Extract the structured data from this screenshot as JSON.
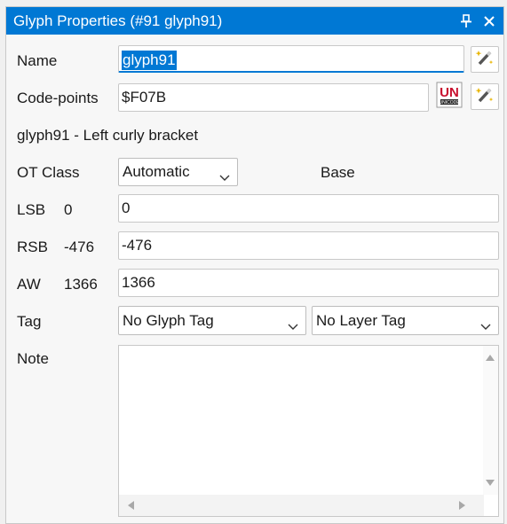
{
  "window": {
    "title": "Glyph Properties (#91 glyph91)",
    "pin_icon": "pin-icon",
    "close_icon": "close-icon"
  },
  "name": {
    "label": "Name",
    "value": "glyph91",
    "wand_icon": "magic-wand-icon"
  },
  "codepoints": {
    "label": "Code-points",
    "value": "$F07B",
    "unicode_icon": "unicode-icon",
    "wand_icon": "magic-wand-icon"
  },
  "description": "glyph91 - Left curly bracket",
  "ot_class": {
    "label": "OT Class",
    "selected": "Automatic",
    "class_name": "Base"
  },
  "metrics": {
    "lsb": {
      "label": "LSB",
      "readout": "0",
      "value": "0"
    },
    "rsb": {
      "label": "RSB",
      "readout": "-476",
      "value": "-476"
    },
    "aw": {
      "label": "AW",
      "readout": "1366",
      "value": "1366"
    }
  },
  "tag": {
    "label": "Tag",
    "glyph_tag": "No Glyph Tag",
    "layer_tag": "No Layer Tag"
  },
  "note": {
    "label": "Note",
    "value": ""
  },
  "colors": {
    "accent": "#0078d4",
    "panel": "#f7f7f7",
    "border": "#c8c8c8"
  }
}
